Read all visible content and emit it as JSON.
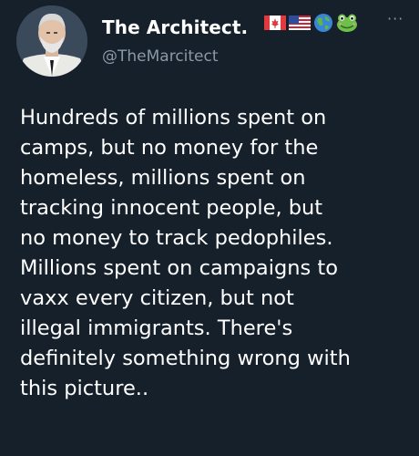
{
  "tweet": {
    "display_name": "The Architect.",
    "handle": "@TheMarcitect",
    "more_label": "···",
    "body": "Hundreds of millions spent on\ncamps, but no money for the\nhomeless, millions spent on\ntracking innocent people, but\nno money to track pedophiles.\nMillions spent on campaigns to\nvaxx every citizen, but not\nillegal immigrants. There's\ndefinitely something wrong with\nthis picture.."
  },
  "name_icons": [
    "canada-flag-icon",
    "us-flag-icon",
    "globe-icon",
    "frog-icon"
  ],
  "colors": {
    "background": "#15202b",
    "text": "#ffffff",
    "muted": "#8b98a5"
  }
}
